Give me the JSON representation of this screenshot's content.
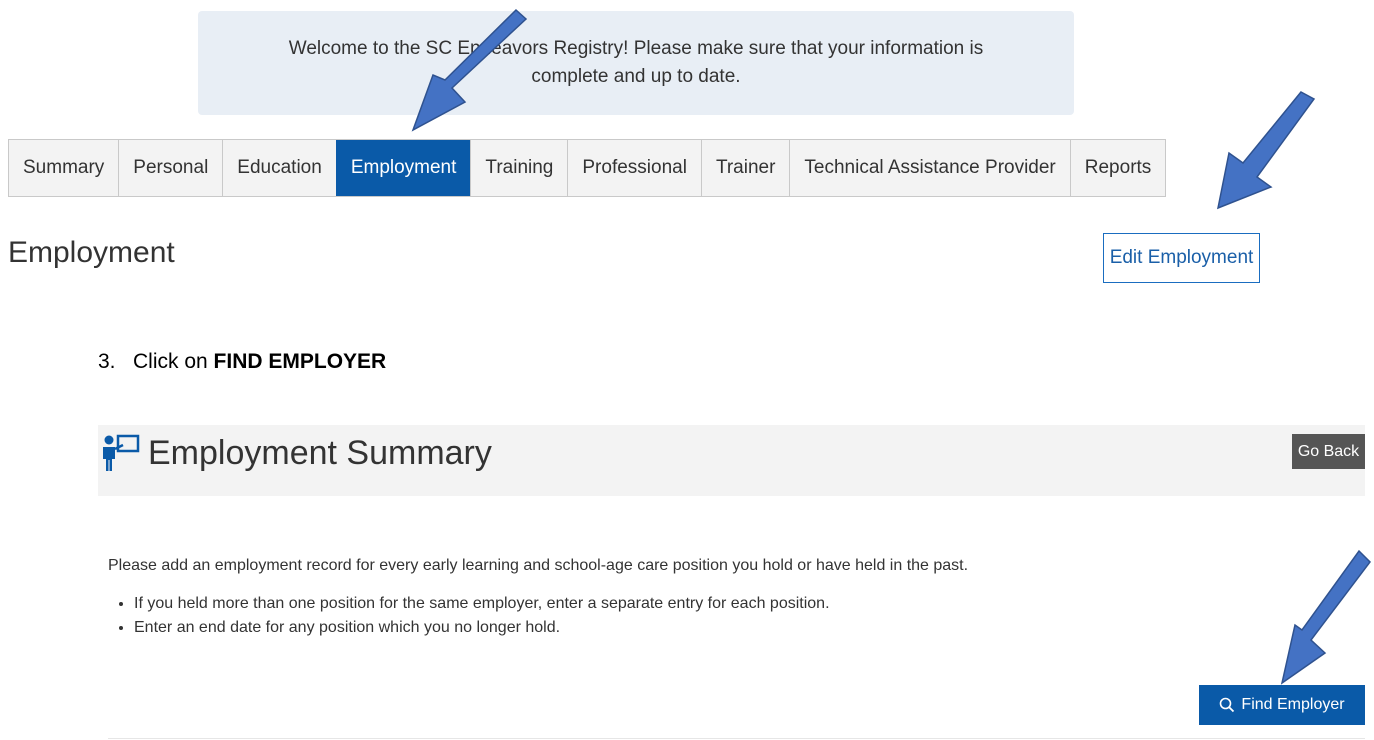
{
  "banner": {
    "text_line1": "Welcome to the SC Endeavors Registry! Please make sure that your information is",
    "text_line2": "complete and up to date."
  },
  "tabs": [
    {
      "label": "Summary"
    },
    {
      "label": "Personal"
    },
    {
      "label": "Education"
    },
    {
      "label": "Employment",
      "active": true
    },
    {
      "label": "Training"
    },
    {
      "label": "Professional"
    },
    {
      "label": "Trainer"
    },
    {
      "label": "Technical Assistance Provider"
    },
    {
      "label": "Reports"
    }
  ],
  "page": {
    "heading": "Employment",
    "edit_button": "Edit Employment"
  },
  "instruction": {
    "prefix": "3.   Click on ",
    "emphasis": "FIND EMPLOYER"
  },
  "summary": {
    "title": "Employment Summary",
    "icon": "teacher-board-icon",
    "go_back": "Go Back",
    "intro": "Please add an employment record for every early learning and school-age care position you hold or have held in the past.",
    "bullets": [
      "If you held more than one position for the same employer, enter a separate entry for each position.",
      "Enter an end date for any position which you no longer hold."
    ],
    "find_button": "Find Employer",
    "find_icon": "search-icon"
  },
  "colors": {
    "accent": "#0a5aa8",
    "banner_bg": "#e8eef5",
    "arrow_fill": "#4472c4",
    "arrow_stroke": "#2f528f"
  }
}
